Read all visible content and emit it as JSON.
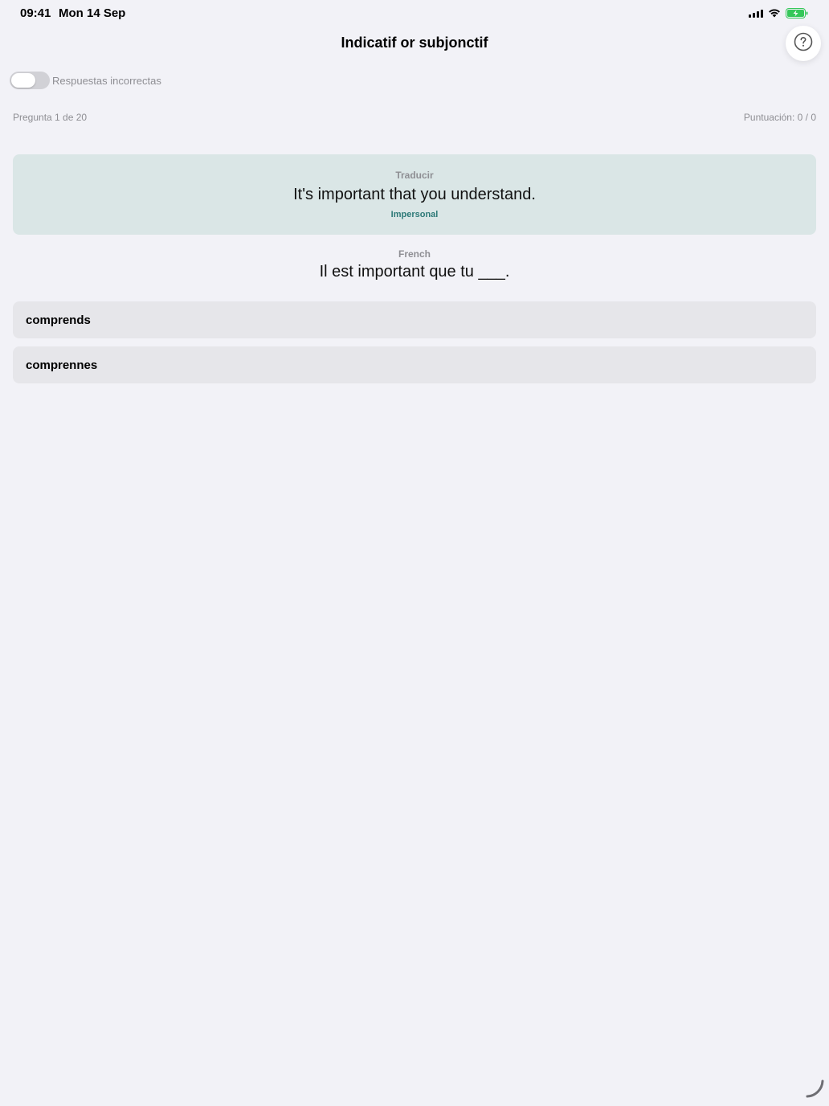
{
  "status_bar": {
    "time": "09:41",
    "date": "Mon 14 Sep",
    "icons": [
      "signal-icon",
      "wifi-icon",
      "battery-charging-icon"
    ]
  },
  "header": {
    "title": "Indicatif or subjonctif",
    "help_icon": "question-circle-icon"
  },
  "toggle": {
    "label": "Respuestas incorrectas",
    "on": false
  },
  "progress": {
    "question": "Pregunta 1 de 20",
    "score": "Puntuación: 0 / 0"
  },
  "translate_card": {
    "label": "Traducir",
    "sentence": "It's important that you understand.",
    "tag": "Impersonal"
  },
  "prompt": {
    "label": "French",
    "sentence": "Il est important que tu ___."
  },
  "options": [
    {
      "label": "comprends"
    },
    {
      "label": "comprennes"
    }
  ],
  "colors": {
    "background": "#f2f2f7",
    "card": "#dae6e6",
    "tag": "#2e7a78",
    "option": "#e6e6ea",
    "secondary_text": "#8e8e93",
    "battery": "#34c759"
  }
}
